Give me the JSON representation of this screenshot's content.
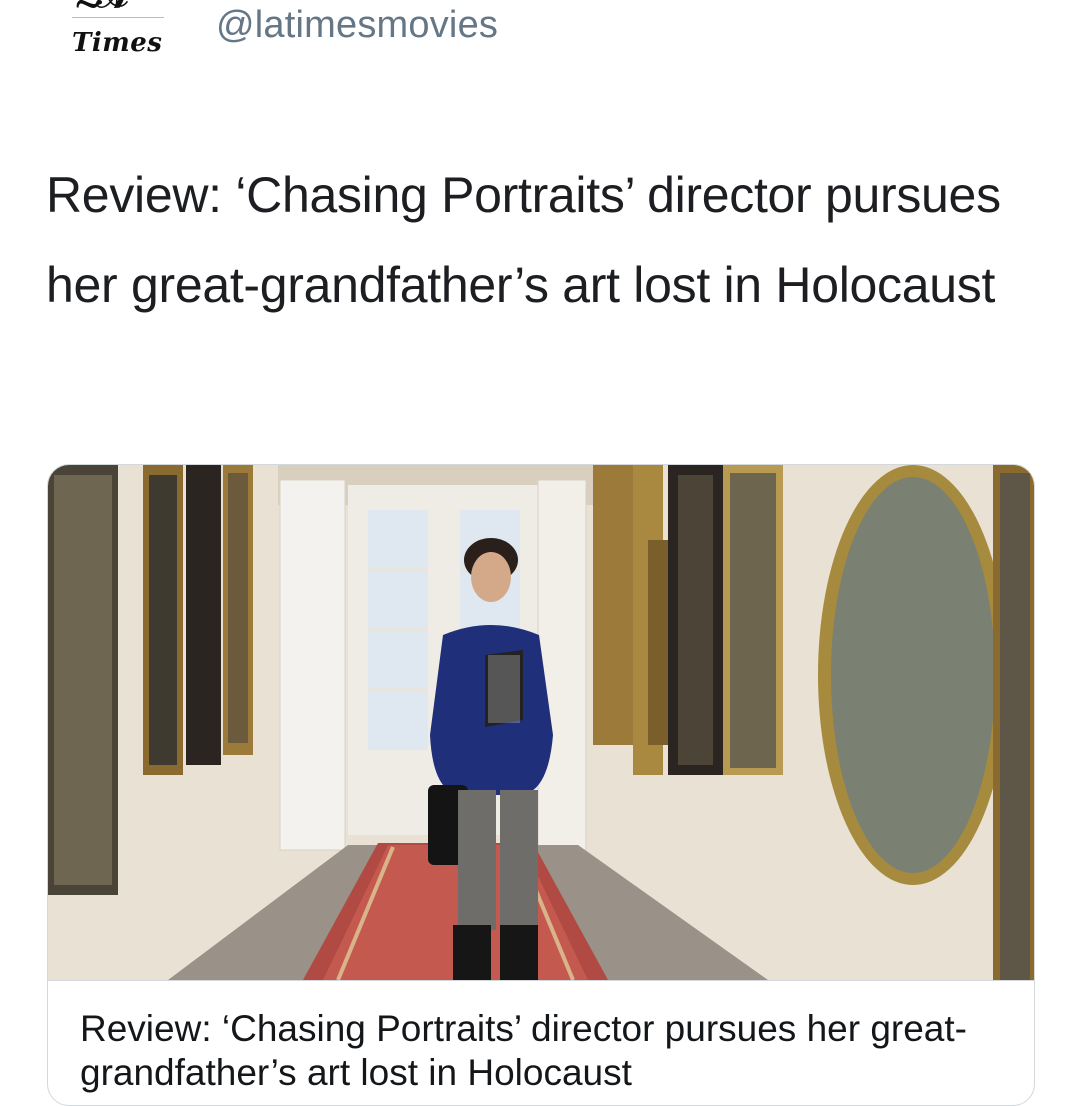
{
  "account": {
    "logo_text": "Times",
    "handle": "@latimesmovies"
  },
  "tweet": {
    "text": "Review: ‘Chasing Portraits’ director pursues her great-grandfather’s art lost in Holocaust"
  },
  "card": {
    "image_description_name": "hallway-with-portraits-photo",
    "title": "Review: ‘Chasing Portraits’ director pursues her great-grandfather’s art lost in Holocaust"
  },
  "colors": {
    "handle": "#657786",
    "text": "#14171a",
    "card_border": "#d3d8dc"
  }
}
